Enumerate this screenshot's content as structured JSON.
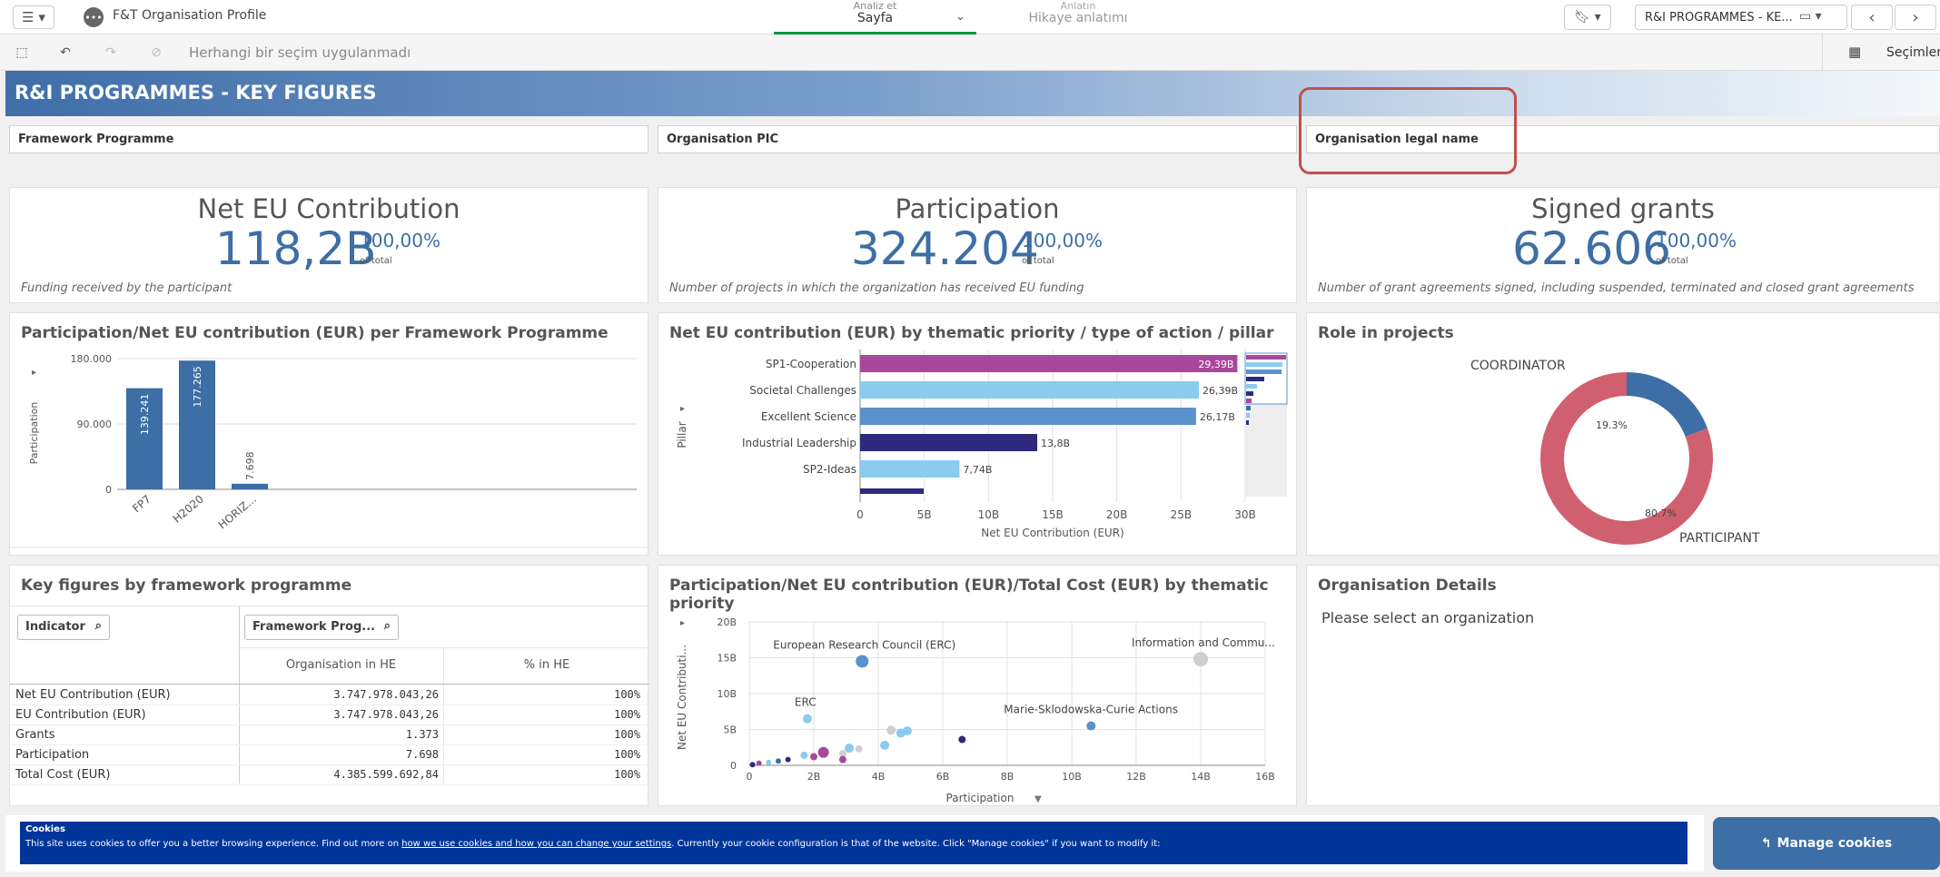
{
  "topbar": {
    "app_title": "F&T Organisation Profile",
    "tab_analyze_small": "Analiz et",
    "tab_analyze": "Sayfa",
    "tab_story_small": "Anlatın",
    "tab_story": "Hikaye anlatımı",
    "sheet_name": "R&I PROGRAMMES - KE..."
  },
  "selbar": {
    "no_selection": "Herhangi bir seçim uygulanmadı",
    "selections_label": "Seçimler"
  },
  "banner": {
    "title": "R&I PROGRAMMES - KEY FIGURES"
  },
  "filters": [
    "Framework Programme",
    "Organisation PIC",
    "Organisation legal name"
  ],
  "kpis": [
    {
      "title": "Net EU Contribution",
      "value": "118,2B",
      "pct": "100,00%",
      "of": "of total",
      "desc": "Funding received by the participant"
    },
    {
      "title": "Participation",
      "value": "324.204",
      "pct": "100,00%",
      "of": "of total",
      "desc": "Number of projects in which the organization has received EU funding"
    },
    {
      "title": "Signed grants",
      "value": "62.606",
      "pct": "100,00%",
      "of": "of total",
      "desc": "Number of grant agreements signed, including suspended, terminated and closed grant agreements"
    }
  ],
  "panels": {
    "fp_chart_title": "Participation/Net EU contribution (EUR) per Framework Programme",
    "thematic_title": "Net EU contribution (EUR) by thematic priority / type of action / pillar",
    "role_title": "Role in projects",
    "keyfig_title": "Key figures by framework programme",
    "scatter_title": "Participation/Net EU contribution (EUR)/Total Cost (EUR) by thematic priority",
    "orgdetails_title": "Organisation Details",
    "orgdetails_msg": "Please select an organization"
  },
  "keyfig_table": {
    "indicator_header": "Indicator",
    "fp_header": "Framework Prog...",
    "col1": "Organisation in HE",
    "col2": "% in HE",
    "rows": [
      {
        "label": "Net EU Contribution (EUR)",
        "v1": "3.747.978.043,26",
        "v2": "100%"
      },
      {
        "label": "EU Contribution (EUR)",
        "v1": "3.747.978.043,26",
        "v2": "100%"
      },
      {
        "label": "Grants",
        "v1": "1.373",
        "v2": "100%"
      },
      {
        "label": "Participation",
        "v1": "7.698",
        "v2": "100%"
      },
      {
        "label": "Total Cost (EUR)",
        "v1": "4.385.599.692,84",
        "v2": "100%"
      }
    ]
  },
  "cookies": {
    "title": "Cookies",
    "text_before": "This site uses cookies to offer you a better browsing experience. Find out more on ",
    "link": "how we use cookies and how you can change your settings",
    "text_after": ". Currently your cookie configuration is that of the website. Click \"Manage cookies\" if you want to modify it:",
    "manage_label": "Manage cookies"
  },
  "chart_data": [
    {
      "type": "bar",
      "title": "Participation/Net EU contribution (EUR) per Framework Programme",
      "ylabel": "Participation",
      "categories": [
        "FP7",
        "H2020",
        "HORIZ..."
      ],
      "values": [
        139241,
        177265,
        7698
      ],
      "value_labels": [
        "139.241",
        "177.265",
        "7.698"
      ],
      "yticks": [
        "180.000",
        "90.000",
        "0"
      ],
      "ylim": [
        0,
        180000
      ],
      "color": "#3d6ea5"
    },
    {
      "type": "bar",
      "title": "Net EU contribution (EUR) by thematic priority / type of action / pillar",
      "orientation": "horizontal",
      "ylabel": "Pillar",
      "xlabel": "Net EU Contribution (EUR)",
      "categories": [
        "SP1-Cooperation",
        "Societal Challenges",
        "Excellent Science",
        "Industrial Leadership",
        "SP2-Ideas"
      ],
      "values": [
        29.39,
        26.39,
        26.17,
        13.8,
        7.74
      ],
      "value_labels": [
        "29,39B",
        "26,39B",
        "26,17B",
        "13,8B",
        "7,74B"
      ],
      "colors": [
        "#a8479c",
        "#8acbee",
        "#5b91cc",
        "#2d2a7e",
        "#8acbee"
      ],
      "xticks": [
        "0",
        "5B",
        "10B",
        "15B",
        "20B",
        "25B",
        "30B"
      ],
      "xlim": [
        0,
        30
      ]
    },
    {
      "type": "pie",
      "title": "Role in projects",
      "labels": [
        "COORDINATOR",
        "PARTICIPANT"
      ],
      "values": [
        19.3,
        80.7
      ],
      "value_labels": [
        "19.3%",
        "80.7%"
      ],
      "colors": [
        "#3d6ea5",
        "#d0606f"
      ]
    },
    {
      "type": "scatter",
      "title": "Participation/Net EU contribution (EUR)/Total Cost (EUR) by thematic priority",
      "xlabel": "Participation",
      "ylabel": "Net EU Contributi...",
      "xticks": [
        "0",
        "2B",
        "4B",
        "6B",
        "8B",
        "10B",
        "12B",
        "14B",
        "16B"
      ],
      "yticks": [
        "20B",
        "15B",
        "10B",
        "5B",
        "0"
      ],
      "xlim": [
        0,
        16
      ],
      "ylim": [
        0,
        20
      ],
      "points": [
        {
          "x": 3.5,
          "y": 14.5,
          "r": 7,
          "color": "#5b91cc",
          "label": "European Research Council (ERC)"
        },
        {
          "x": 14.0,
          "y": 14.8,
          "r": 8,
          "color": "#cfcfcf",
          "label": "Information and Commu..."
        },
        {
          "x": 1.8,
          "y": 6.5,
          "r": 5,
          "color": "#8acbee",
          "label": "ERC"
        },
        {
          "x": 10.6,
          "y": 5.5,
          "r": 5,
          "color": "#5b91cc",
          "label": "Marie-Sklodowska-Curie Actions"
        },
        {
          "x": 6.6,
          "y": 3.6,
          "r": 4,
          "color": "#2d2a7e",
          "label": ""
        },
        {
          "x": 4.7,
          "y": 4.5,
          "r": 5,
          "color": "#8acbee",
          "label": ""
        },
        {
          "x": 4.9,
          "y": 4.8,
          "r": 5,
          "color": "#8acbee",
          "label": ""
        },
        {
          "x": 4.4,
          "y": 4.9,
          "r": 5,
          "color": "#cfcfcf",
          "label": ""
        },
        {
          "x": 4.2,
          "y": 2.8,
          "r": 5,
          "color": "#8acbee",
          "label": ""
        },
        {
          "x": 3.1,
          "y": 2.4,
          "r": 5,
          "color": "#8acbee",
          "label": ""
        },
        {
          "x": 3.4,
          "y": 2.3,
          "r": 4,
          "color": "#cfcfcf",
          "label": ""
        },
        {
          "x": 2.3,
          "y": 1.8,
          "r": 6,
          "color": "#a8479c",
          "label": ""
        },
        {
          "x": 2.9,
          "y": 1.6,
          "r": 4,
          "color": "#cfcfcf",
          "label": ""
        },
        {
          "x": 2.9,
          "y": 0.8,
          "r": 4,
          "color": "#a8479c",
          "label": ""
        },
        {
          "x": 2.0,
          "y": 1.2,
          "r": 4,
          "color": "#a8479c",
          "label": ""
        },
        {
          "x": 1.7,
          "y": 1.4,
          "r": 4,
          "color": "#8acbee",
          "label": ""
        },
        {
          "x": 1.2,
          "y": 0.8,
          "r": 3,
          "color": "#2d2a7e",
          "label": ""
        },
        {
          "x": 0.9,
          "y": 0.6,
          "r": 3,
          "color": "#3d6ea5",
          "label": ""
        },
        {
          "x": 0.6,
          "y": 0.4,
          "r": 3,
          "color": "#8acbee",
          "label": ""
        },
        {
          "x": 0.3,
          "y": 0.3,
          "r": 3,
          "color": "#a8479c",
          "label": ""
        },
        {
          "x": 0.1,
          "y": 0.1,
          "r": 3,
          "color": "#2d2a7e",
          "label": ""
        }
      ]
    }
  ]
}
